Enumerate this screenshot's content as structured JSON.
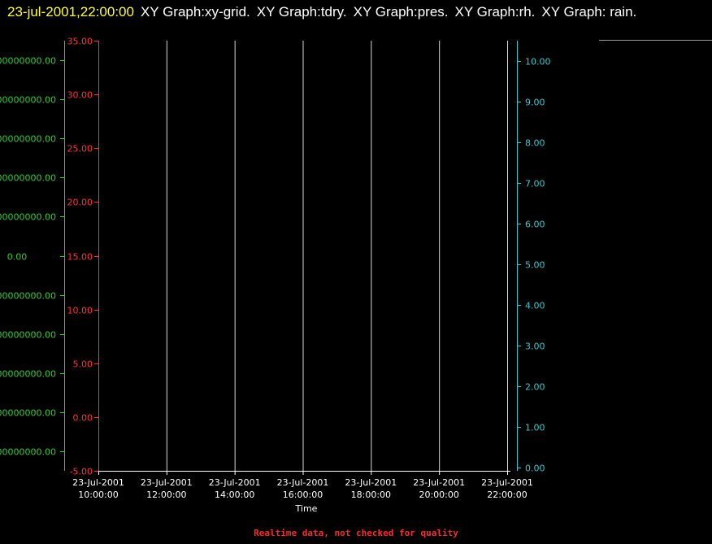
{
  "header": {
    "timestamp": "23-jul-2001,22:00:00",
    "graphs": [
      "XY Graph:xy-grid.",
      "XY Graph:tdry.",
      "XY Graph:pres.",
      "XY Graph:rh.",
      "XY Graph: rain."
    ]
  },
  "footer": {
    "note": "Realtime data, not checked for quality"
  },
  "chart_data": {
    "type": "line",
    "grid": "vertical",
    "xlabel": "Time",
    "x_ticks": [
      {
        "date": "23-Jul-2001",
        "time": "10:00:00"
      },
      {
        "date": "23-Jul-2001",
        "time": "12:00:00"
      },
      {
        "date": "23-Jul-2001",
        "time": "14:00:00"
      },
      {
        "date": "23-Jul-2001",
        "time": "16:00:00"
      },
      {
        "date": "23-Jul-2001",
        "time": "18:00:00"
      },
      {
        "date": "23-Jul-2001",
        "time": "20:00:00"
      },
      {
        "date": "23-Jul-2001",
        "time": "22:00:00"
      }
    ],
    "xlim": [
      "23-Jul-2001 10:00:00",
      "23-Jul-2001 22:00:00"
    ],
    "axes": [
      {
        "id": "green",
        "color": "#33cc33",
        "side": "far-left",
        "ticks": [
          "00000000.00",
          "00000000.00",
          "00000000.00",
          "00000000.00",
          "00000000.00",
          "0.00",
          "00000000.00",
          "00000000.00",
          "00000000.00",
          "00000000.00",
          "00000000.00"
        ]
      },
      {
        "id": "red",
        "color": "#ff3333",
        "side": "left",
        "ylim": [
          -5,
          35
        ],
        "ticks": [
          "35.00",
          "30.00",
          "25.00",
          "20.00",
          "15.00",
          "10.00",
          "5.00",
          "0.00",
          "-5.00"
        ]
      },
      {
        "id": "cyan",
        "color": "#33cccc",
        "side": "right",
        "ylim": [
          0,
          10
        ],
        "ticks": [
          "10.00",
          "9.00",
          "8.00",
          "7.00",
          "6.00",
          "5.00",
          "4.00",
          "3.00",
          "2.00",
          "1.00",
          "0.00"
        ]
      }
    ],
    "series": []
  }
}
